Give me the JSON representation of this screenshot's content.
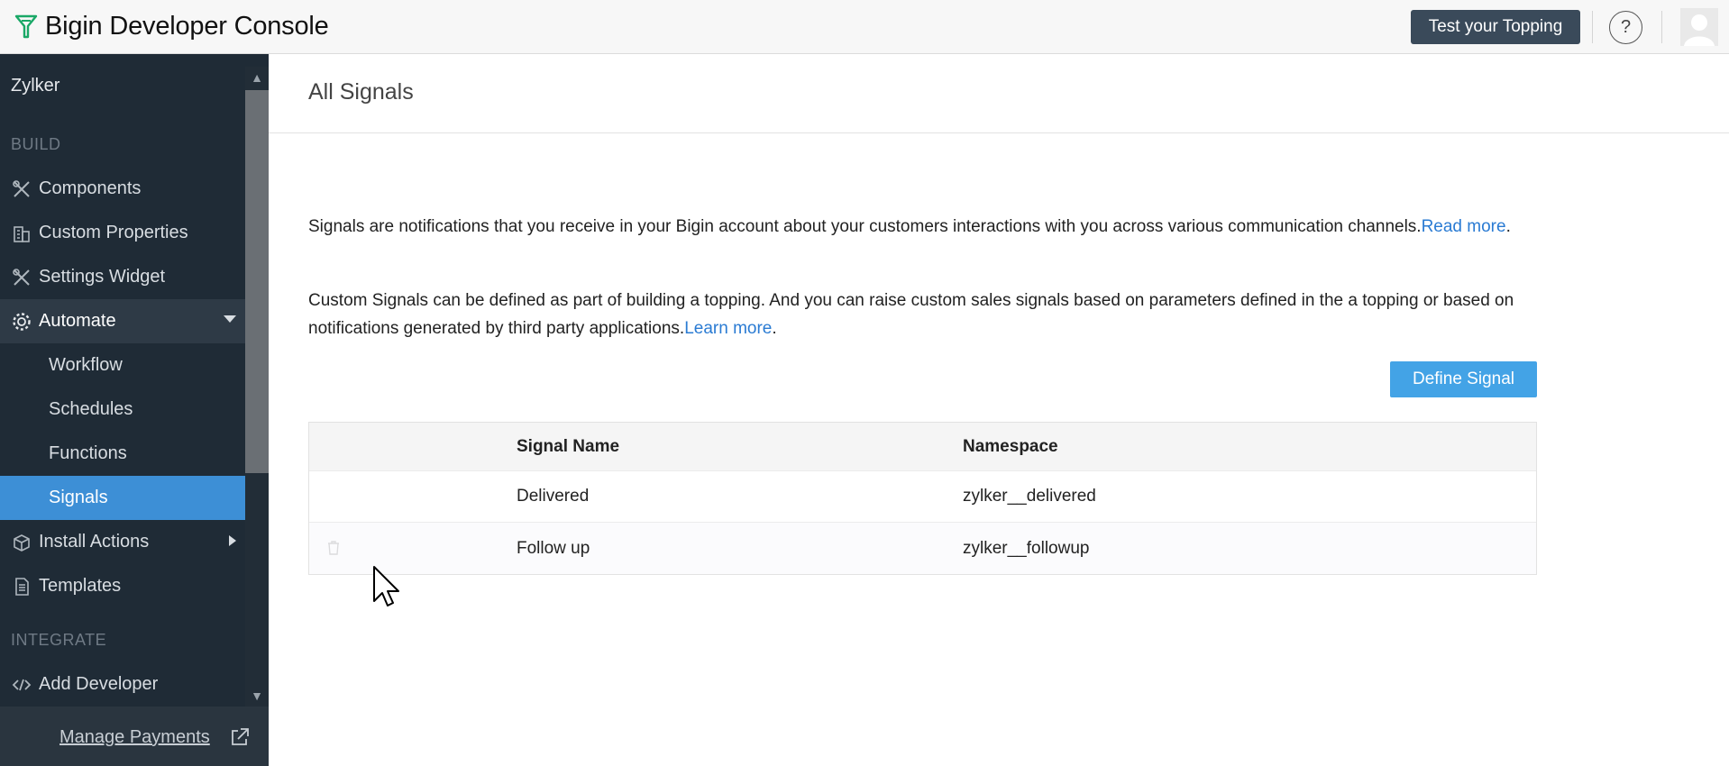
{
  "header": {
    "app_title": "Bigin Developer Console",
    "test_button": "Test your Topping",
    "help_label": "?"
  },
  "sidebar": {
    "org_name": "Zylker",
    "sections": {
      "build": "BUILD",
      "integrate": "INTEGRATE"
    },
    "items": [
      {
        "label": "Components",
        "icon": "tools-icon"
      },
      {
        "label": "Custom Properties",
        "icon": "building-icon"
      },
      {
        "label": "Settings Widget",
        "icon": "tools-icon"
      },
      {
        "label": "Automate",
        "icon": "gear-icon",
        "expanded": true
      },
      {
        "label": "Workflow"
      },
      {
        "label": "Schedules"
      },
      {
        "label": "Functions"
      },
      {
        "label": "Signals",
        "active": true
      },
      {
        "label": "Install Actions",
        "icon": "box-icon"
      },
      {
        "label": "Templates",
        "icon": "document-icon"
      },
      {
        "label": "Add Developer",
        "icon": "code-icon"
      }
    ],
    "footer_link": "Manage Payments"
  },
  "main": {
    "title": "All Signals",
    "para1": {
      "text": "Signals are notifications that you receive in your Bigin account about your customers interactions with you across various communication channels.",
      "link": "Read more",
      "tail": "."
    },
    "para2": {
      "text": "Custom Signals can be defined as part of building a topping. And you can raise custom sales signals based on parameters defined in the a topping or based on notifications generated by third party applications.",
      "link": "Learn more",
      "tail": "."
    },
    "define_button": "Define Signal",
    "table": {
      "columns": [
        "Signal Name",
        "Namespace"
      ],
      "rows": [
        {
          "name": "Delivered",
          "namespace": "zylker__delivered"
        },
        {
          "name": "Follow up",
          "namespace": "zylker__followup"
        }
      ]
    }
  },
  "colors": {
    "sidebar_bg": "#1f2b36",
    "active_item": "#3d8fd6",
    "primary_button": "#43a3e6",
    "dark_button": "#3a4a5a",
    "link": "#2a7bd3"
  }
}
